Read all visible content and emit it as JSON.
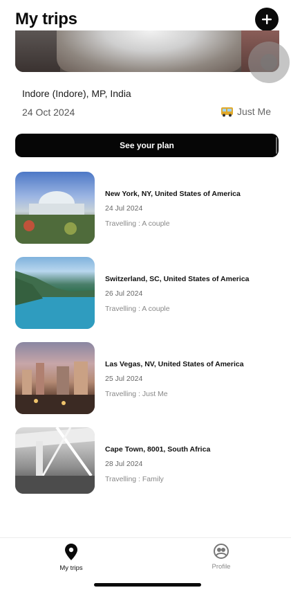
{
  "header": {
    "title": "My trips",
    "add_icon": "plus-icon"
  },
  "featured": {
    "location": "Indore (Indore), MP, India",
    "date": "24 Oct 2024",
    "companion": "Just Me",
    "companion_icon": "bus-icon",
    "cta_label": "See your plan"
  },
  "trips": [
    {
      "title": "New York, NY, United States of America",
      "date": "24 Jul 2024",
      "travelling": "Travelling : A couple"
    },
    {
      "title": "Switzerland, SC, United States of America",
      "date": "26 Jul 2024",
      "travelling": "Travelling : A couple"
    },
    {
      "title": "Las Vegas, NV, United States of America",
      "date": "25 Jul 2024",
      "travelling": "Travelling : Just Me"
    },
    {
      "title": "Cape Town, 8001, South Africa",
      "date": "28 Jul 2024",
      "travelling": "Travelling : Family"
    }
  ],
  "nav": {
    "items": [
      {
        "label": "My trips",
        "icon": "map-pin-icon",
        "active": true
      },
      {
        "label": "Profile",
        "icon": "profile-icon",
        "active": false
      }
    ]
  },
  "colors": {
    "primary": "#0a0a0a",
    "muted_text": "#888888",
    "accent_bus": "#e0a92b"
  }
}
